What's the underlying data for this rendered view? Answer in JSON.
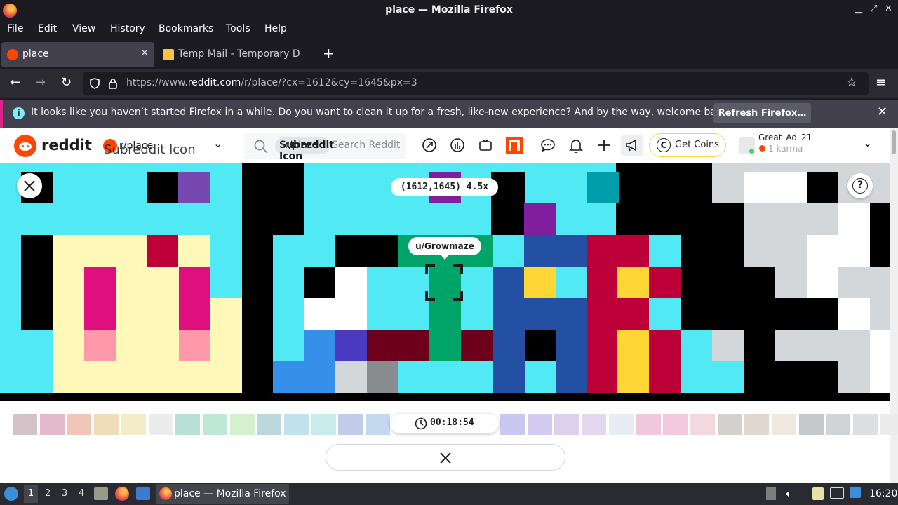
{
  "window": {
    "title": "place — Mozilla Firefox"
  },
  "menu": [
    "File",
    "Edit",
    "View",
    "History",
    "Bookmarks",
    "Tools",
    "Help"
  ],
  "tabs": [
    {
      "label": "place",
      "active": true
    },
    {
      "label": "Temp Mail - Temporary D",
      "active": false
    }
  ],
  "url": {
    "prefix": "https://www.",
    "host": "reddit.com",
    "path": "/r/place/?cx=1612&cy=1645&px=3"
  },
  "notification": {
    "message": "It looks like you haven’t started Firefox in a while. Do you want to clean it up for a fresh, like-new experience? And by the way, welcome back!",
    "button": "Refresh Firefox…"
  },
  "reddit": {
    "logo_text": "reddit",
    "community": "r/place",
    "community_alt": "Subreddit Icon",
    "search_chip": "Subreddit Icon",
    "search_chip_text": "r/place",
    "search_placeholder": "Search Reddit",
    "get_coins": "Get Coins",
    "username": "Great_Ad_21",
    "karma": "1 karma"
  },
  "place": {
    "coordinates": "(1612,1645) 4.5x",
    "pixel_owner": "u/Growmaze",
    "timer": "00:18:54"
  },
  "taskbar": {
    "workspaces": [
      "1",
      "2",
      "3",
      "4"
    ],
    "window_label": "place — Mozilla Firefox",
    "clock": "16:20"
  },
  "colors": {
    "reddit_orange": "#ff4500",
    "firefox_bg": "#1c1b22",
    "notification_accent": "#e0218a"
  }
}
